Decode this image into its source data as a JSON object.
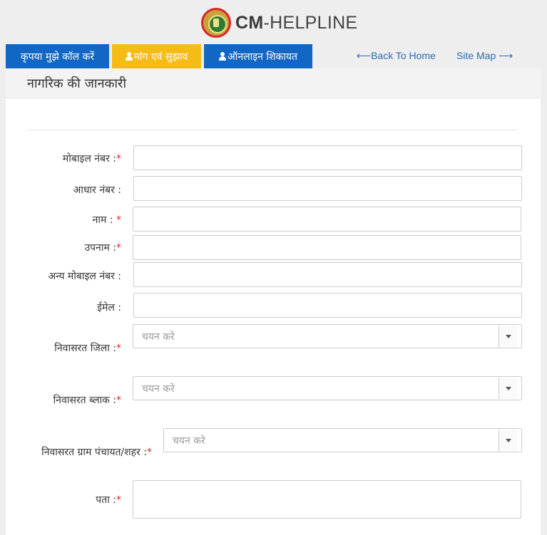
{
  "header": {
    "brand_bold": "CM",
    "brand_rest": "-HELPLINE"
  },
  "tabs": [
    {
      "label": "कृपया मुझे कॉल करें"
    },
    {
      "label": "मांग एवं सुझाव"
    },
    {
      "label": "ऑनलाइन शिकायत"
    }
  ],
  "nav": {
    "back_home": "⟵Back To Home",
    "site_map": "Site Map ⟶"
  },
  "panel": {
    "title": "नागरिक की जानकारी"
  },
  "form": {
    "mobile": {
      "label": "मोबाइल नंबर :",
      "required": "*",
      "value": ""
    },
    "aadhar": {
      "label": "आधार नंबर :",
      "value": ""
    },
    "name": {
      "label": "नाम :",
      "required": "*",
      "value": ""
    },
    "surname": {
      "label": "उपनाम :",
      "required": "*",
      "value": ""
    },
    "alt_mobile": {
      "label": "अन्य मोबाइल नंबर :",
      "value": ""
    },
    "email": {
      "label": "ईमेल :",
      "value": ""
    },
    "district": {
      "label": "निवासरत जिला :",
      "required": "*",
      "placeholder": "चयन करे"
    },
    "block": {
      "label": "निवासरत ब्लाक :",
      "required": "*",
      "placeholder": "चयन करे"
    },
    "gram": {
      "label": "निवासरत ग्राम पंचायत/शहर :",
      "required": "*",
      "placeholder": "चयन करे"
    },
    "address": {
      "label": "पता :",
      "required": "*",
      "value": ""
    }
  },
  "colors": {
    "tab_blue": "#1266c4",
    "tab_yellow": "#f6bc16",
    "link_blue": "#2b6cb0",
    "required_red": "#d9262a"
  }
}
